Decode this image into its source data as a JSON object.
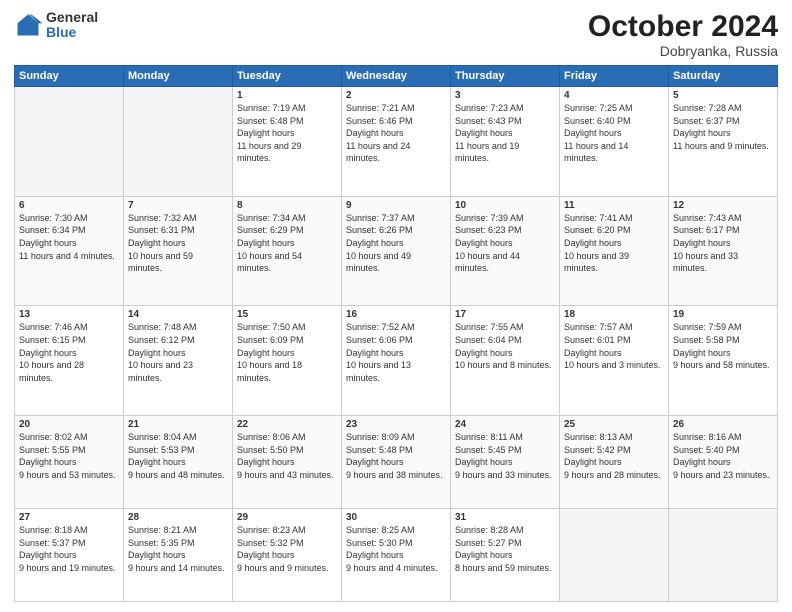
{
  "header": {
    "logo_general": "General",
    "logo_blue": "Blue",
    "month_title": "October 2024",
    "location": "Dobryanka, Russia"
  },
  "days_of_week": [
    "Sunday",
    "Monday",
    "Tuesday",
    "Wednesday",
    "Thursday",
    "Friday",
    "Saturday"
  ],
  "weeks": [
    [
      {
        "day": "",
        "empty": true
      },
      {
        "day": "",
        "empty": true
      },
      {
        "day": "1",
        "sunrise": "7:19 AM",
        "sunset": "6:48 PM",
        "daylight": "11 hours and 29 minutes."
      },
      {
        "day": "2",
        "sunrise": "7:21 AM",
        "sunset": "6:46 PM",
        "daylight": "11 hours and 24 minutes."
      },
      {
        "day": "3",
        "sunrise": "7:23 AM",
        "sunset": "6:43 PM",
        "daylight": "11 hours and 19 minutes."
      },
      {
        "day": "4",
        "sunrise": "7:25 AM",
        "sunset": "6:40 PM",
        "daylight": "11 hours and 14 minutes."
      },
      {
        "day": "5",
        "sunrise": "7:28 AM",
        "sunset": "6:37 PM",
        "daylight": "11 hours and 9 minutes."
      }
    ],
    [
      {
        "day": "6",
        "sunrise": "7:30 AM",
        "sunset": "6:34 PM",
        "daylight": "11 hours and 4 minutes."
      },
      {
        "day": "7",
        "sunrise": "7:32 AM",
        "sunset": "6:31 PM",
        "daylight": "10 hours and 59 minutes."
      },
      {
        "day": "8",
        "sunrise": "7:34 AM",
        "sunset": "6:29 PM",
        "daylight": "10 hours and 54 minutes."
      },
      {
        "day": "9",
        "sunrise": "7:37 AM",
        "sunset": "6:26 PM",
        "daylight": "10 hours and 49 minutes."
      },
      {
        "day": "10",
        "sunrise": "7:39 AM",
        "sunset": "6:23 PM",
        "daylight": "10 hours and 44 minutes."
      },
      {
        "day": "11",
        "sunrise": "7:41 AM",
        "sunset": "6:20 PM",
        "daylight": "10 hours and 39 minutes."
      },
      {
        "day": "12",
        "sunrise": "7:43 AM",
        "sunset": "6:17 PM",
        "daylight": "10 hours and 33 minutes."
      }
    ],
    [
      {
        "day": "13",
        "sunrise": "7:46 AM",
        "sunset": "6:15 PM",
        "daylight": "10 hours and 28 minutes."
      },
      {
        "day": "14",
        "sunrise": "7:48 AM",
        "sunset": "6:12 PM",
        "daylight": "10 hours and 23 minutes."
      },
      {
        "day": "15",
        "sunrise": "7:50 AM",
        "sunset": "6:09 PM",
        "daylight": "10 hours and 18 minutes."
      },
      {
        "day": "16",
        "sunrise": "7:52 AM",
        "sunset": "6:06 PM",
        "daylight": "10 hours and 13 minutes."
      },
      {
        "day": "17",
        "sunrise": "7:55 AM",
        "sunset": "6:04 PM",
        "daylight": "10 hours and 8 minutes."
      },
      {
        "day": "18",
        "sunrise": "7:57 AM",
        "sunset": "6:01 PM",
        "daylight": "10 hours and 3 minutes."
      },
      {
        "day": "19",
        "sunrise": "7:59 AM",
        "sunset": "5:58 PM",
        "daylight": "9 hours and 58 minutes."
      }
    ],
    [
      {
        "day": "20",
        "sunrise": "8:02 AM",
        "sunset": "5:55 PM",
        "daylight": "9 hours and 53 minutes."
      },
      {
        "day": "21",
        "sunrise": "8:04 AM",
        "sunset": "5:53 PM",
        "daylight": "9 hours and 48 minutes."
      },
      {
        "day": "22",
        "sunrise": "8:06 AM",
        "sunset": "5:50 PM",
        "daylight": "9 hours and 43 minutes."
      },
      {
        "day": "23",
        "sunrise": "8:09 AM",
        "sunset": "5:48 PM",
        "daylight": "9 hours and 38 minutes."
      },
      {
        "day": "24",
        "sunrise": "8:11 AM",
        "sunset": "5:45 PM",
        "daylight": "9 hours and 33 minutes."
      },
      {
        "day": "25",
        "sunrise": "8:13 AM",
        "sunset": "5:42 PM",
        "daylight": "9 hours and 28 minutes."
      },
      {
        "day": "26",
        "sunrise": "8:16 AM",
        "sunset": "5:40 PM",
        "daylight": "9 hours and 23 minutes."
      }
    ],
    [
      {
        "day": "27",
        "sunrise": "8:18 AM",
        "sunset": "5:37 PM",
        "daylight": "9 hours and 19 minutes."
      },
      {
        "day": "28",
        "sunrise": "8:21 AM",
        "sunset": "5:35 PM",
        "daylight": "9 hours and 14 minutes."
      },
      {
        "day": "29",
        "sunrise": "8:23 AM",
        "sunset": "5:32 PM",
        "daylight": "9 hours and 9 minutes."
      },
      {
        "day": "30",
        "sunrise": "8:25 AM",
        "sunset": "5:30 PM",
        "daylight": "9 hours and 4 minutes."
      },
      {
        "day": "31",
        "sunrise": "8:28 AM",
        "sunset": "5:27 PM",
        "daylight": "8 hours and 59 minutes."
      },
      {
        "day": "",
        "empty": true
      },
      {
        "day": "",
        "empty": true
      }
    ]
  ]
}
